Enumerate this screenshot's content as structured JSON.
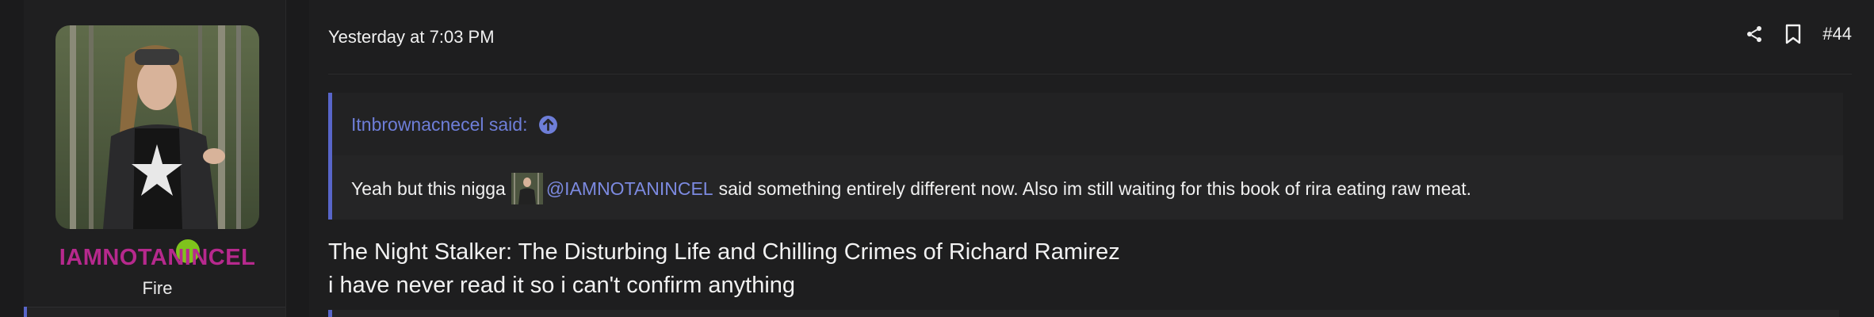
{
  "user": {
    "username": "IAMNOTANINCEL",
    "title": "Fire",
    "status": "online",
    "username_color": "#b6298d",
    "online_color": "#7fc31c"
  },
  "post": {
    "timestamp": "Yesterday at 7:03 PM",
    "number": "#44",
    "actions": {
      "share_icon": "share-icon",
      "bookmark_icon": "bookmark-icon"
    },
    "quote": {
      "author_said": "Itnbrownacnecel said:",
      "expand_icon": "arrow-up-circle-icon",
      "text_before": "Yeah but this nigga",
      "mention": "@IAMNOTANINCEL",
      "text_after": "said something entirely different now. Also im still waiting for this book of rira eating raw meat."
    },
    "body_lines": [
      "The Night Stalker: The Disturbing Life and Chilling Crimes of Richard Ramirez",
      "i have never read it so i can't confirm anything"
    ]
  },
  "colors": {
    "accent": "#5865c9",
    "link": "#6e7ed8",
    "background": "#1b1b1c"
  }
}
